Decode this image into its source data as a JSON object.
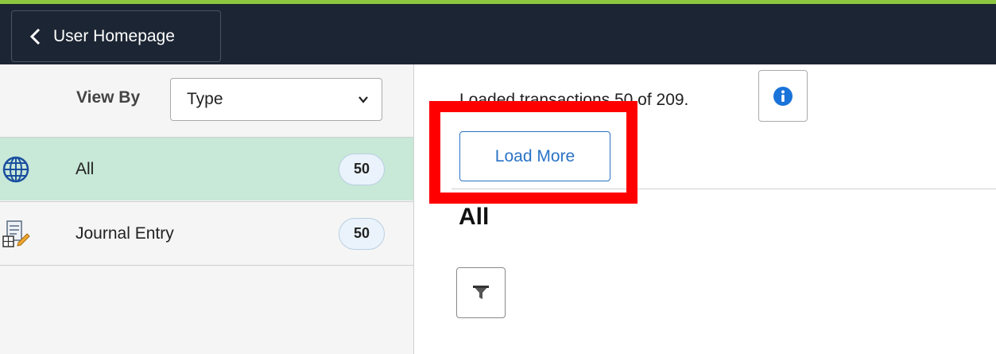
{
  "header": {
    "back_label": "User Homepage",
    "colors": {
      "bar": "#1c2533",
      "accent_strip": "#8cc63f"
    }
  },
  "sidebar": {
    "view_by_label": "View By",
    "view_by_value": "Type",
    "items": [
      {
        "label": "All",
        "count": "50",
        "icon": "globe-icon",
        "active": true
      },
      {
        "label": "Journal Entry",
        "count": "50",
        "icon": "journal-entry-icon",
        "active": false
      }
    ],
    "colors": {
      "active_bg": "#c8e8d8"
    }
  },
  "main": {
    "status_text": "Loaded transactions 50 of 209.",
    "info_icon": "info-icon",
    "load_more_label": "Load More",
    "section_title": "All",
    "filter_icon": "filter-icon",
    "colors": {
      "link_blue": "#2a73c5",
      "info_blue": "#1a73d9"
    }
  },
  "annotation": {
    "color": "#ff0000"
  }
}
